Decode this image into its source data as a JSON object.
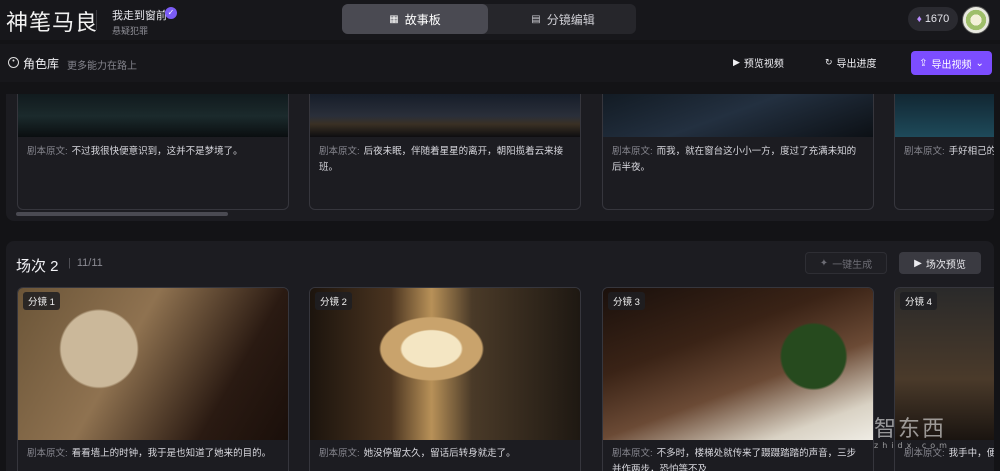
{
  "topbar": {
    "brand": "神笔马良",
    "project_title": "我走到窗前",
    "project_sub": "悬疑犯罪",
    "tabs": [
      {
        "label": "故事板",
        "active": true,
        "icon": "grid-icon"
      },
      {
        "label": "分镜编辑",
        "active": false,
        "icon": "layers-icon"
      }
    ],
    "credits": "1670"
  },
  "toolbar": {
    "role_library": "角色库",
    "role_hint": "更多能力在路上",
    "preview_video": "预览视频",
    "export_progress": "导出进度",
    "export_video": "导出视频"
  },
  "scene1": {
    "cards": [
      {
        "label": "剧本原文:",
        "text": "不过我很快便意识到，这并不是梦境了。"
      },
      {
        "label": "剧本原文:",
        "text": "后夜未眠，伴随着星星的离开，朝阳揽着云来接班。"
      },
      {
        "label": "剧本原文:",
        "text": "而我，就在窗台这小小一方，度过了充满未知的后半夜。"
      },
      {
        "label": "剧本原文:",
        "text": "手好相己的感觉了。"
      }
    ]
  },
  "scene2": {
    "title": "场次 2",
    "count": "11/11",
    "generate": "一键生成",
    "preview": "场次预览",
    "cards": [
      {
        "badge": "分镜 1",
        "label": "剧本原文:",
        "text": "看看墙上的时钟，我于是也知道了她来的目的。"
      },
      {
        "badge": "分镜 2",
        "label": "剧本原文:",
        "text": "她没停留太久，留话后转身就走了。"
      },
      {
        "badge": "分镜 3",
        "label": "剧本原文:",
        "text": "不多时，楼梯处就传来了蹑蹑踏踏的声音，三步并作两步，恐怕等不及"
      },
      {
        "badge": "分镜 4",
        "label": "剧本原文:",
        "text": "我手中，便也关门下"
      }
    ]
  },
  "watermark": {
    "main": "智东西",
    "sub": "zhidx.com"
  },
  "colors": {
    "accent": "#7c4dff",
    "background": "#131316",
    "panel": "#1c1c21"
  }
}
